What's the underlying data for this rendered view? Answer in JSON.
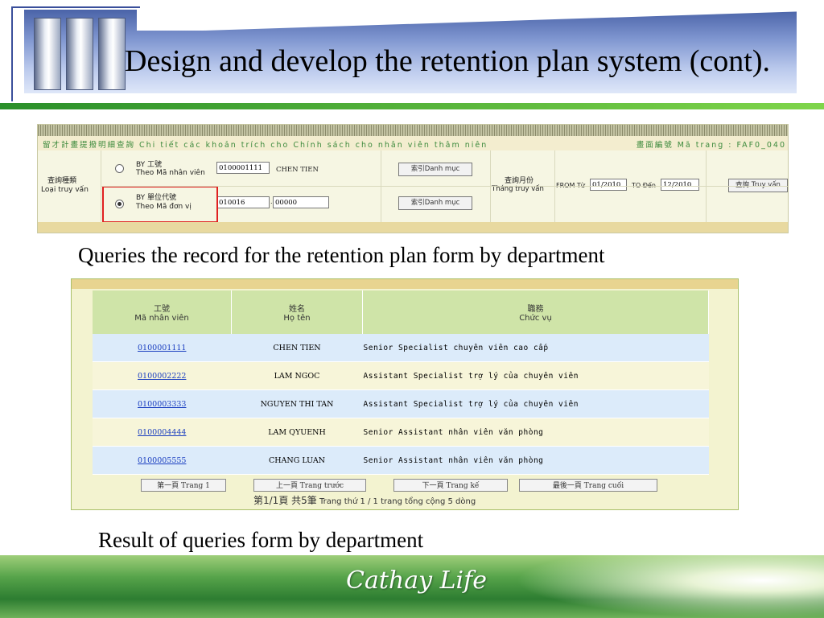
{
  "slide": {
    "title": "Design and develop the retention plan system (cont).",
    "caption_query": "Queries the record for the retention plan form by department",
    "caption_result": "Result of queries form by department",
    "brand": "Cathay Life"
  },
  "query_form": {
    "subtitle": "留才計畫提撥明細查詢 Chi tiết các khoản trích cho Chính sách cho nhân viên thâm niên",
    "page_code": "畫面編號 Mã trang : FAF0_040",
    "query_type_zh": "查詢種類",
    "query_type_vi": "Loại truy vấn",
    "options": [
      {
        "code": "BY 工號",
        "label": "Theo Mã nhân viên",
        "value1": "0100001111",
        "value2": "CHEN TIEN",
        "button": "索引Danh mục",
        "selected": false
      },
      {
        "code": "BY 單位代號",
        "label": "Theo Mã đơn vị",
        "value1": "010016",
        "value2": "00000",
        "button": "索引Danh mục",
        "selected": true
      }
    ],
    "month_zh": "查詢月份",
    "month_vi": "Tháng truy vấn",
    "from_label": "FROM Từ",
    "from_value": "01/2010",
    "to_label": "TO Đến",
    "to_value": "12/2010",
    "search_button": "查詢 Truy vấn"
  },
  "results": {
    "columns": [
      {
        "zh": "工號",
        "vi": "Mã nhân viên"
      },
      {
        "zh": "姓名",
        "vi": "Họ tên"
      },
      {
        "zh": "職務",
        "vi": "Chức vụ"
      }
    ],
    "rows": [
      {
        "id": "0100001111",
        "name": "CHEN TIEN",
        "position": "Senior Specialist chuyên viên cao cấp"
      },
      {
        "id": "0100002222",
        "name": "LAM NGOC",
        "position": "Assistant Specialist trợ lý của chuyên viên"
      },
      {
        "id": "0100003333",
        "name": "NGUYEN THI TAN",
        "position": "Assistant Specialist trợ lý của chuyên viên"
      },
      {
        "id": "0100004444",
        "name": "LAM QYUENH",
        "position": "Senior Assistant nhân viên văn phòng"
      },
      {
        "id": "0100005555",
        "name": "CHANG LUAN",
        "position": "Senior Assistant nhân viên văn phòng"
      }
    ],
    "pager": {
      "first": "第一頁 Trang 1",
      "prev": "上一頁 Trang trước",
      "next": "下一頁 Trang kế",
      "last": "最後一頁 Trang cuối",
      "info_zh": "第1/1頁 共5筆",
      "info_vi": "Trang thứ 1 / 1 trang tổng cộng 5 dòng"
    }
  }
}
